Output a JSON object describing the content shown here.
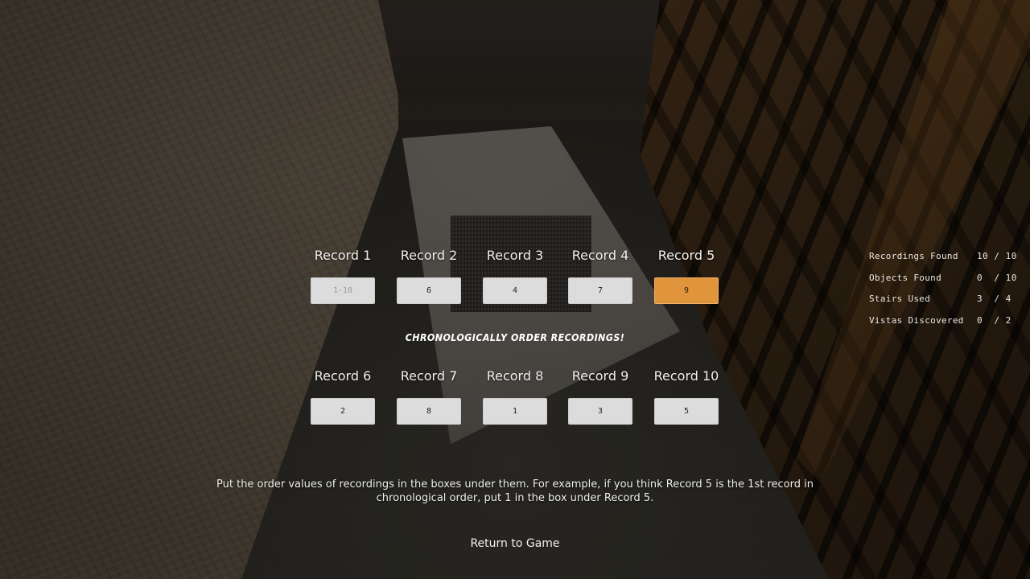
{
  "puzzle": {
    "heading": "Chronologically Order Recordings!",
    "records": [
      {
        "label": "Record 1",
        "value": "",
        "placeholder": "1-10",
        "focused": false
      },
      {
        "label": "Record 2",
        "value": "6",
        "placeholder": "1-10",
        "focused": false
      },
      {
        "label": "Record 3",
        "value": "4",
        "placeholder": "1-10",
        "focused": false
      },
      {
        "label": "Record 4",
        "value": "7",
        "placeholder": "1-10",
        "focused": false
      },
      {
        "label": "Record 5",
        "value": "9",
        "placeholder": "1-10",
        "focused": true
      },
      {
        "label": "Record 6",
        "value": "2",
        "placeholder": "1-10",
        "focused": false
      },
      {
        "label": "Record 7",
        "value": "8",
        "placeholder": "1-10",
        "focused": false
      },
      {
        "label": "Record 8",
        "value": "1",
        "placeholder": "1-10",
        "focused": false
      },
      {
        "label": "Record 9",
        "value": "3",
        "placeholder": "1-10",
        "focused": false
      },
      {
        "label": "Record 10",
        "value": "5",
        "placeholder": "1-10",
        "focused": false
      }
    ],
    "instructions": "Put the order values of recordings in the boxes under them. For example, if you think Record 5 is the 1st record in chronological order, put 1 in the box under Record 5.",
    "return_label": "Return to Game"
  },
  "stats": [
    {
      "label": "Recordings Found",
      "value": "10 / 10"
    },
    {
      "label": "Objects Found",
      "value": "0  / 10"
    },
    {
      "label": "Stairs Used",
      "value": "3  / 4"
    },
    {
      "label": "Vistas Discovered",
      "value": "0  / 2"
    }
  ],
  "colors": {
    "focused_input": "#e0953d",
    "input_bg": "#dcdcdc",
    "text": "#f2f0ec"
  }
}
